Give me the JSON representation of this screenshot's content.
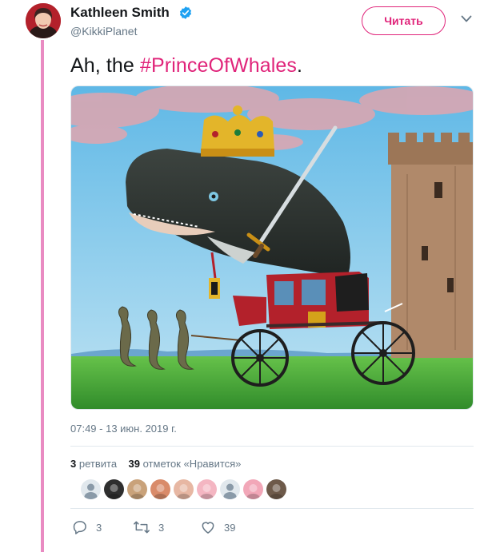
{
  "tweet": {
    "author": {
      "name": "Kathleen Smith",
      "handle": "@KikkiPlanet",
      "verified_color": "#1da1f2"
    },
    "follow_label": "Читать",
    "text_prefix": "Ah, the ",
    "hashtag": "#PrinceOfWhales",
    "text_suffix": ".",
    "timestamp": "07:49 - 13 июн. 2019 г.",
    "stats": {
      "retweets_count": "3",
      "retweets_label": "ретвита",
      "likes_count": "39",
      "likes_label": "отметок «Нравится»"
    },
    "likers": [
      {
        "color": "#8a9aa8",
        "icon": "default-avatar"
      },
      {
        "color": "#2f2f2f",
        "icon": "photo-avatar"
      },
      {
        "color": "#c9a27a",
        "icon": "photo-avatar"
      },
      {
        "color": "#d98b6a",
        "icon": "photo-avatar"
      },
      {
        "color": "#e7b7a3",
        "icon": "photo-avatar"
      },
      {
        "color": "#f4b6c2",
        "icon": "photo-avatar"
      },
      {
        "color": "#8a9aa8",
        "icon": "default-avatar"
      },
      {
        "color": "#f2a7b8",
        "icon": "photo-avatar"
      },
      {
        "color": "#6e5a4a",
        "icon": "photo-avatar"
      }
    ],
    "actions": {
      "reply_count": "3",
      "retweet_count": "3",
      "like_count": "39"
    },
    "colors": {
      "accent": "#e0247a",
      "thread_line": "#e98bc2",
      "muted_text": "#657786"
    }
  }
}
